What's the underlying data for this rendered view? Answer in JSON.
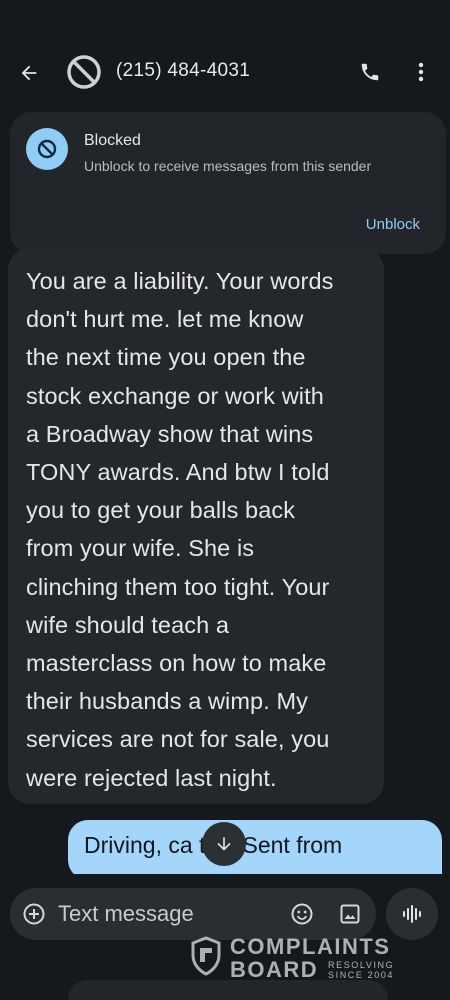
{
  "header": {
    "contact_number": "(215) 484-4031",
    "back_icon": "arrow-back-icon",
    "avatar_icon": "blocked-icon",
    "call_icon": "phone-icon",
    "more_icon": "more-vert-icon"
  },
  "blocked_banner": {
    "title": "Blocked",
    "subtitle": "Unblock to receive messages from this sender",
    "action_label": "Unblock",
    "icon": "block-icon"
  },
  "messages": [
    {
      "direction": "incoming",
      "text": "You are a liability. Your words\ndon't hurt me. let me know\nthe next time you open the\nstock exchange or work with\na Broadway show that wins\nTONY awards. And btw I told\nyou to get your balls back\nfrom your wife. She is\nclinching them too tight. Your\nwife should teach a\nmasterclass on how to make\ntheir husbands a wimp. My\nservices are not for sale, you\nwere rejected last night."
    },
    {
      "direction": "outgoing",
      "text": "Driving, ca   text.Sent from"
    }
  ],
  "scroll_down_icon": "arrow-down-icon",
  "composer": {
    "placeholder": "Text message",
    "add_icon": "add-circle-icon",
    "emoji_icon": "emoji-icon",
    "media_icon": "image-icon",
    "voice_icon": "voice-waveform-icon"
  },
  "watermark": {
    "line1": "COMPLAINTS",
    "line2": "BOARD",
    "tagline1": "RESOLVING",
    "tagline2": "SINCE 2004"
  },
  "colors": {
    "background": "#15191d",
    "bubble_incoming": "#24282d",
    "bubble_outgoing": "#a4d5fb",
    "accent": "#8fcdf6"
  }
}
